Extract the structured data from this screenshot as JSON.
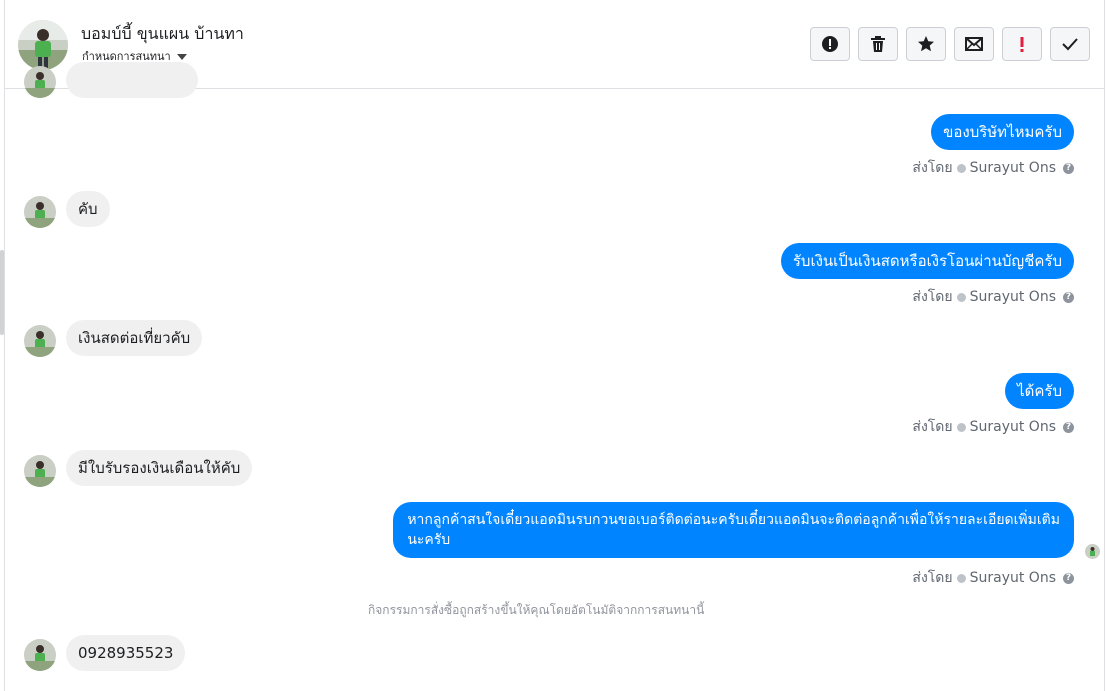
{
  "header": {
    "contact_name": "บอมบ์บี้ ขุนแผน บ้านทา",
    "assign_label": "กำหนดการสนทนา",
    "actions": [
      {
        "name": "mark-spam-button",
        "icon": "exclamation-circle-icon"
      },
      {
        "name": "delete-button",
        "icon": "trash-icon"
      },
      {
        "name": "star-button",
        "icon": "star-icon"
      },
      {
        "name": "mark-unread-button",
        "icon": "envelope-icon"
      },
      {
        "name": "follow-up-button",
        "icon": "red-exclamation-icon"
      },
      {
        "name": "mark-done-button",
        "icon": "checkmark-icon"
      }
    ]
  },
  "messages": {
    "m1": "ของบริษัทไหมครับ",
    "m2": "คับ",
    "m3": "รับเงินเป็นเงินสดหรือเงิรโอนผ่านบัญชีครับ",
    "m4": "เงินสดต่อเที่ยวคับ",
    "m5": "ได้ครับ",
    "m6": "มีใบรับรองเงินเดือนให้คับ",
    "m7_line1": "หากลูกค้าสนใจเดี๋ยวแอดมินรบกวนขอเบอร์ติดต่อนะครับเดี๋ยวแอดมินจะติดต่อลูกค้าเพื่อให้รายละเอียดเพิ่มเติม",
    "m7_line2": "นะครับ",
    "m8": "0928935523"
  },
  "sent_by": {
    "prefix": "ส่งโดย",
    "name": "Surayut Ons"
  },
  "system_note": "กิจกรรมการสั่งซื้อถูกสร้างขึ้นให้คุณโดยอัตโนมัติจากการสนทนานี้",
  "colors": {
    "outgoing_bubble": "#0084ff",
    "incoming_bubble": "#f1f0f0",
    "follow_up_icon": "#e41e3f"
  }
}
